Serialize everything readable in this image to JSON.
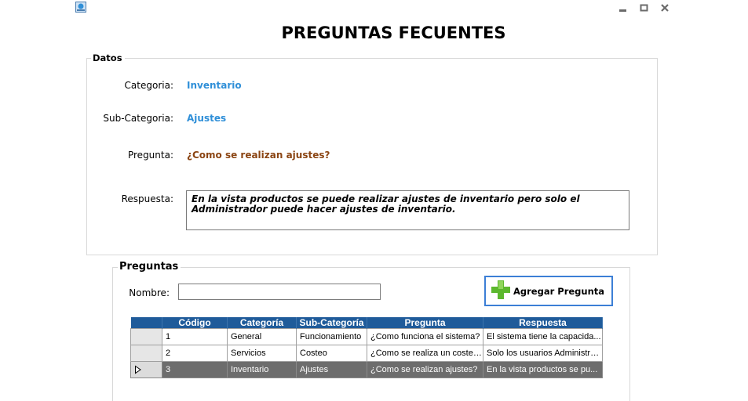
{
  "window": {
    "title": "PREGUNTAS FECUENTES",
    "icon": "app-icon",
    "controls": [
      "minimize-icon",
      "maximize-icon",
      "close-icon"
    ]
  },
  "datos": {
    "legend": "Datos",
    "categoria_label": "Categoria:",
    "categoria_value": "Inventario",
    "subcategoria_label": "Sub-Categoria:",
    "subcategoria_value": "Ajustes",
    "pregunta_label": "Pregunta:",
    "pregunta_value": "¿Como se realizan ajustes?",
    "respuesta_label": "Respuesta:",
    "respuesta_value": "En la vista productos se puede realizar ajustes de inventario pero solo el Administrador puede hacer ajustes de inventario."
  },
  "preguntas": {
    "legend": "Preguntas",
    "nombre_label": "Nombre:",
    "nombre_value": "",
    "add_button_label": "Agregar Pregunta",
    "columns": [
      "Código",
      "Categoría",
      "Sub-Categoría",
      "Pregunta",
      "Respuesta"
    ],
    "rows": [
      {
        "codigo": "1",
        "categoria": "General",
        "subcategoria": "Funcionamiento",
        "pregunta": "¿Como funciona el sistema?",
        "respuesta": "El sistema tiene la capacida..."
      },
      {
        "codigo": "2",
        "categoria": "Servicios",
        "subcategoria": "Costeo",
        "pregunta": "¿Como se realiza un costeo?",
        "respuesta": "Solo los usuarios Administra..."
      },
      {
        "codigo": "3",
        "categoria": "Inventario",
        "subcategoria": "Ajustes",
        "pregunta": "¿Como se realizan ajustes?",
        "respuesta": "En la vista productos se pu..."
      }
    ],
    "selected_row": 3
  },
  "colors": {
    "value_blue": "#2f8fd8",
    "value_brown": "#8b4513",
    "header_blue": "#1f5b9a",
    "selected_row": "#6d6d6d",
    "add_icon_green": "#5cb82e"
  }
}
